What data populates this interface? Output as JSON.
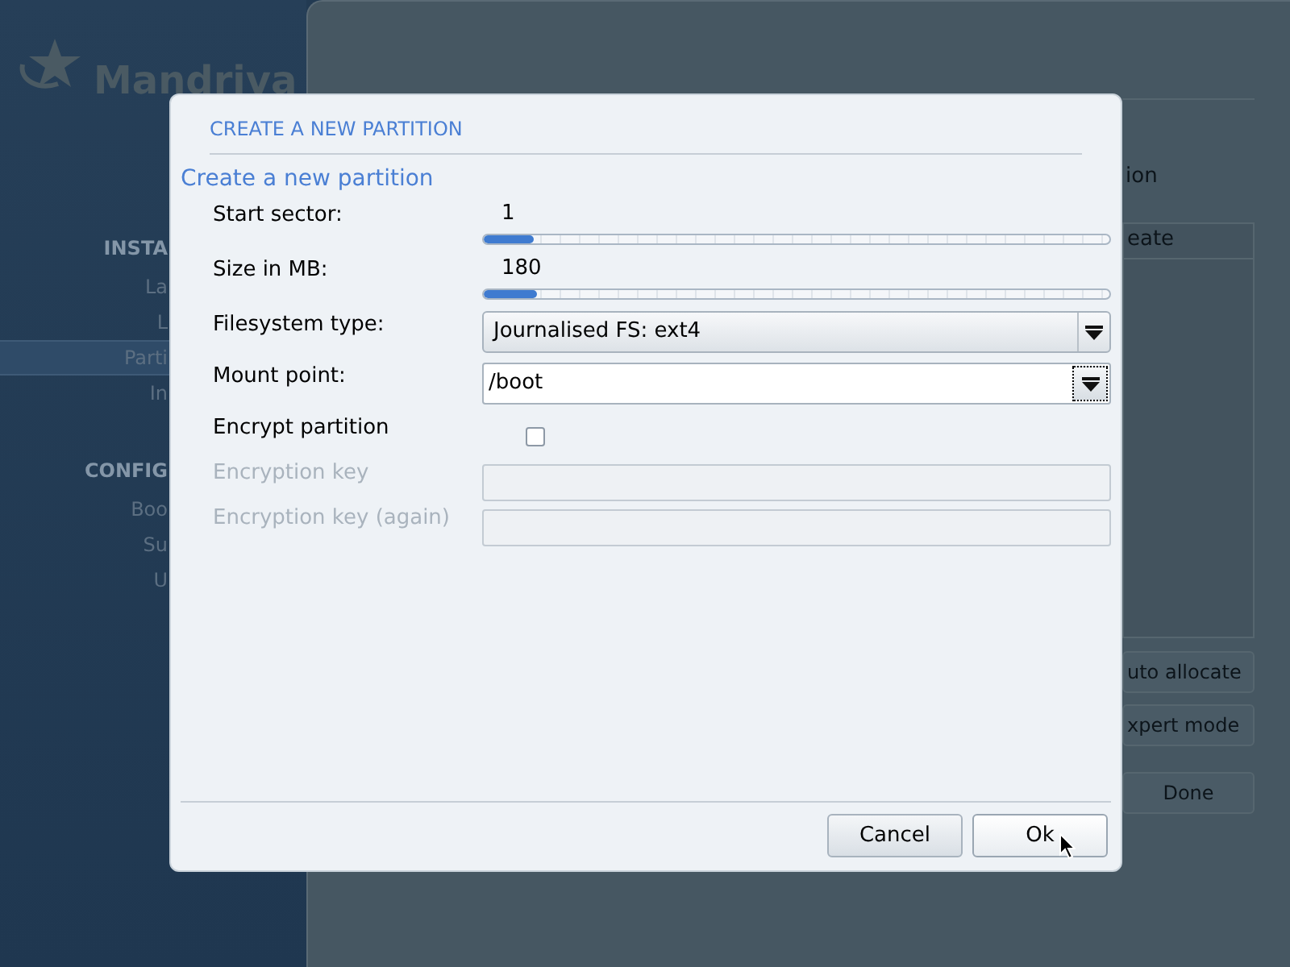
{
  "background": {
    "logo": "Mandriva",
    "sidebar": {
      "sections": [
        {
          "title": "INSTA",
          "items": [
            {
              "label": "La",
              "selected": false
            },
            {
              "label": "L",
              "selected": false
            },
            {
              "label": "Parti",
              "selected": true
            },
            {
              "label": "In",
              "selected": false
            }
          ]
        },
        {
          "title": "CONFIG",
          "items": [
            {
              "label": "Boo",
              "selected": false
            },
            {
              "label": "Su",
              "selected": false
            },
            {
              "label": "U",
              "selected": false
            }
          ]
        }
      ]
    },
    "main": {
      "heading": "ion",
      "table": {
        "columns": [
          "eate"
        ]
      },
      "buttons": [
        "uto allocate",
        "xpert mode",
        "Done"
      ]
    }
  },
  "dialog": {
    "title": "CREATE A NEW PARTITION",
    "heading": "Create a new partition",
    "fields": [
      {
        "kind": "slider",
        "label": "Start sector:",
        "value": "1",
        "level": 0.08
      },
      {
        "kind": "slider",
        "label": "Size in MB:",
        "value": "180",
        "level": 0.085
      },
      {
        "kind": "dropdown",
        "label": "Filesystem type:",
        "value": "Journalised FS: ext4"
      },
      {
        "kind": "combo",
        "label": "Mount point:",
        "value": "/boot"
      },
      {
        "kind": "checkbox",
        "label": "Encrypt partition",
        "checked": false
      },
      {
        "kind": "text",
        "label": "Encryption key",
        "disabled": true
      },
      {
        "kind": "text",
        "label": "Encryption key (again)",
        "disabled": true
      }
    ],
    "buttons": [
      {
        "label": "Cancel",
        "focused": false
      },
      {
        "label": "Ok",
        "focused": true
      }
    ]
  }
}
